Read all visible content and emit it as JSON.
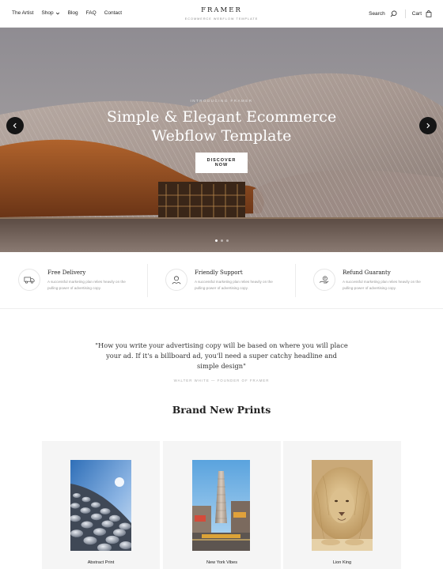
{
  "nav": {
    "links": [
      {
        "label": "The Artist"
      },
      {
        "label": "Shop"
      },
      {
        "label": "Blog"
      },
      {
        "label": "FAQ"
      },
      {
        "label": "Contact"
      }
    ],
    "brand": "FRAMER",
    "tagline": "ECOMMERCE WEBFLOW TEMPLATE",
    "search_label": "Search",
    "cart_label": "Cart"
  },
  "hero": {
    "eyebrow": "INTRODUCING FRAMER",
    "title_line1": "Simple & Elegant Ecommerce",
    "title_line2": "Webflow Template",
    "button_label": "DISCOVER NOW",
    "slide_count": 3,
    "active_slide": 1
  },
  "features": [
    {
      "title": "Free Delivery",
      "description": "A successful marketing plan relies heavily on the pulling-power of advertising copy.",
      "icon": "truck-icon"
    },
    {
      "title": "Friendly Support",
      "description": "A successful marketing plan relies heavily on the pulling-power of advertising copy.",
      "icon": "support-icon"
    },
    {
      "title": "Refund Guaranty",
      "description": "A successful marketing plan relies heavily on the pulling-power of advertising copy.",
      "icon": "refund-icon"
    }
  ],
  "quote": {
    "text": "\"How you write your advertising copy will be based on where you will place your ad. If it's a billboard ad, you'll need a super catchy headline and simple design\"",
    "author": "WALTER WHITE — FOUNDER OF FRAMER"
  },
  "products": {
    "section_title": "Brand New Prints",
    "items": [
      {
        "name": "Abstract Print"
      },
      {
        "name": "New York Vibes"
      },
      {
        "name": "Lion King"
      }
    ]
  },
  "colors": {
    "accent_dark": "#151515",
    "card_bg": "#f5f5f5",
    "muted_text": "#999999"
  }
}
